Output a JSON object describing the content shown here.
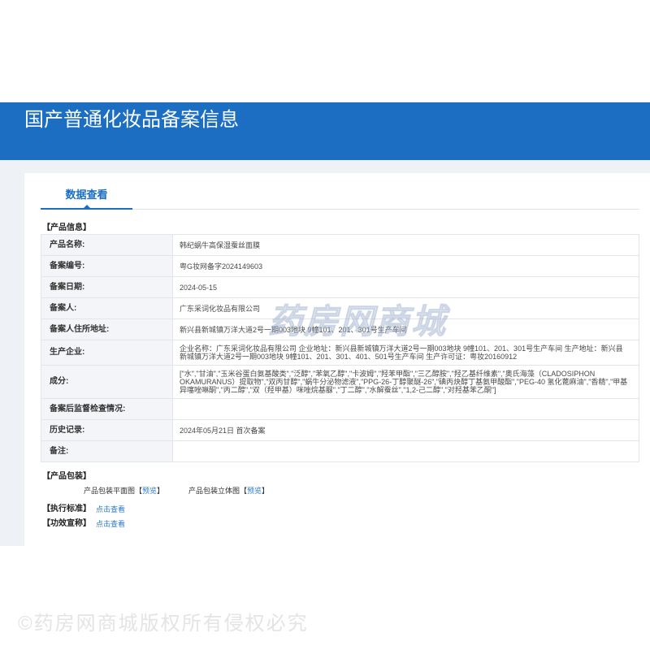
{
  "theme": {
    "header_bg": "#1b6ec2",
    "accent": "#1a6fc4",
    "link": "#2b78d0",
    "page_bg": "#eef1f5"
  },
  "header": {
    "title": "国产普通化妆品备案信息"
  },
  "tabs": [
    {
      "label": "数据查看",
      "active": true
    }
  ],
  "product_info": {
    "section_title": "【产品信息】",
    "rows": [
      {
        "label": "产品名称:",
        "value": "韩纪蜗牛高保湿蚕丝面膜"
      },
      {
        "label": "备案编号:",
        "value": "粤G妆网备字2024149603"
      },
      {
        "label": "备案日期:",
        "value": "2024-05-15"
      },
      {
        "label": "备案人:",
        "value": "广东采词化妆品有限公司"
      },
      {
        "label": "备案人住所地址:",
        "value": "新兴县新城镇万洋大道2号一期003地块 9幢101、201、301号生产车间"
      },
      {
        "label": "生产企业:",
        "value": "企业名称：广东采词化妆品有限公司 企业地址：新兴县新城镇万洋大道2号一期003地块 9幢101、201、301号生产车间 生产地址：新兴县新城镇万洋大道2号一期003地块 9幢101、201、301、401、501号生产车间 生产许可证：粤妆20160912"
      },
      {
        "label": "成分:",
        "value": "[\"水\",\"甘油\",\"玉米谷蛋白氨基酸类\",\"泛醇\",\"苯氧乙醇\",\"卡波姆\",\"羟苯甲酯\",\"三乙醇胺\",\"羟乙基纤维素\",\"奥氏海藻（CLADOSIPHON OKAMURANUS）提取物\",\"双丙甘醇\",\"蜗牛分泌物滤液\",\"PPG-26-丁醇聚醚-26\",\"碘丙炔醇丁基氨甲酸酯\",\"PEG-40 氢化蓖麻油\",\"香精\",\"甲基异噻唑啉酮\",\"丙二醇\",\"双（羟甲基）咪唑烷基脲\",\"丁二醇\",\"水解蚕丝\",\"1,2-己二醇\",\"对羟基苯乙酮\"]"
      },
      {
        "label": "备案后监督检查情况:",
        "value": ""
      },
      {
        "label": "历史记录:",
        "value": "2024年05月21日 首次备案"
      },
      {
        "label": "备注:",
        "value": ""
      }
    ]
  },
  "packaging": {
    "section_title": "【产品包装】",
    "items": [
      {
        "label": "产品包装平面图",
        "bracket_open": "【",
        "link_label": "预览",
        "bracket_close": "】"
      },
      {
        "label": "产品包装立体图",
        "bracket_open": "【",
        "link_label": "预览",
        "bracket_close": "】"
      }
    ]
  },
  "execution_standard": {
    "section_title": "【执行标准】",
    "link_label": "点击查看"
  },
  "efficacy_claim": {
    "section_title": "【功效宣称】",
    "link_label": "点击查看"
  },
  "watermarks": {
    "center": "药房网商城",
    "footer": "©药房网商城版权所有侵权必究"
  }
}
